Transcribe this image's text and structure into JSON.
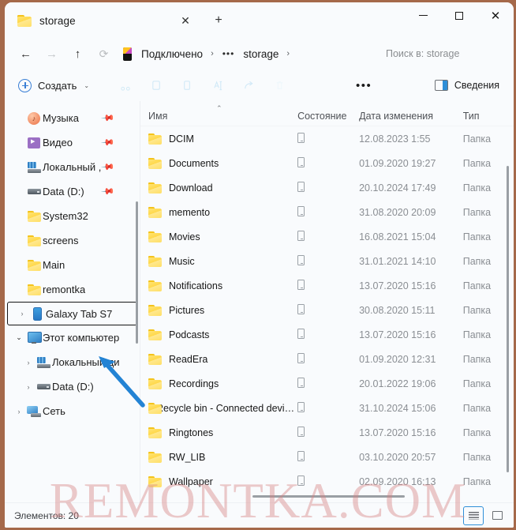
{
  "window": {
    "tab_title": "storage",
    "tab_icon": "folder-icon",
    "close_tab": "✕",
    "new_tab": "+",
    "minimize": "—",
    "maximize": "□",
    "close": "✕"
  },
  "nav": {
    "back": "←",
    "forward": "→",
    "up": "↑",
    "refresh": "⟳"
  },
  "breadcrumb": {
    "device_icon": "phone-icon",
    "items": [
      "Подключено",
      "storage"
    ],
    "ellipsis": "•••",
    "separator": "›"
  },
  "search": {
    "placeholder": "Поиск в: storage",
    "value": ""
  },
  "toolbar": {
    "new_label": "Создать",
    "new_chevron": "⌄",
    "icons": [
      "cut-icon",
      "copy-icon",
      "paste-icon",
      "rename-icon",
      "share-icon",
      "delete-icon"
    ],
    "more_label": "•••",
    "details_label": "Сведения"
  },
  "sidebar": {
    "items": [
      {
        "label": "Музыка",
        "icon": "music-icon",
        "chevron": "",
        "pinned": true,
        "indent": 0
      },
      {
        "label": "Видео",
        "icon": "video-icon",
        "chevron": "",
        "pinned": true,
        "indent": 0
      },
      {
        "label": "Локальный ,",
        "icon": "local-disk-icon",
        "chevron": "",
        "pinned": true,
        "indent": 0
      },
      {
        "label": "Data (D:)",
        "icon": "drive-icon",
        "chevron": "",
        "pinned": true,
        "indent": 0
      },
      {
        "label": "System32",
        "icon": "folder-icon",
        "chevron": "",
        "pinned": false,
        "indent": 0
      },
      {
        "label": "screens",
        "icon": "folder-icon",
        "chevron": "",
        "pinned": false,
        "indent": 0
      },
      {
        "label": "Main",
        "icon": "folder-icon",
        "chevron": "",
        "pinned": false,
        "indent": 0
      },
      {
        "label": "remontka",
        "icon": "folder-icon",
        "chevron": "",
        "pinned": false,
        "indent": 0
      },
      {
        "label": "Galaxy Tab S7",
        "icon": "tablet-icon",
        "chevron": "›",
        "pinned": false,
        "indent": 0,
        "highlight": true
      },
      {
        "label": "Этот компьютер",
        "icon": "this-pc-icon",
        "chevron": "⌄",
        "pinned": false,
        "indent": 0
      },
      {
        "label": "Локальный ди",
        "icon": "local-disk-icon",
        "chevron": "›",
        "pinned": false,
        "indent": 1
      },
      {
        "label": "Data (D:)",
        "icon": "drive-icon",
        "chevron": "›",
        "pinned": false,
        "indent": 1
      },
      {
        "label": "Сеть",
        "icon": "network-icon",
        "chevron": "›",
        "pinned": false,
        "indent": 0
      }
    ],
    "pin_glyph": "📌"
  },
  "columns": {
    "name": "Имя",
    "status": "Состояние",
    "date": "Дата изменения",
    "type": "Тип",
    "sort_arrow": "⌃"
  },
  "files": [
    {
      "name": "DCIM",
      "status": "device-icon",
      "date": "12.08.2023 1:55",
      "type": "Папка"
    },
    {
      "name": "Documents",
      "status": "device-icon",
      "date": "01.09.2020 19:27",
      "type": "Папка"
    },
    {
      "name": "Download",
      "status": "device-icon",
      "date": "20.10.2024 17:49",
      "type": "Папка"
    },
    {
      "name": "memento",
      "status": "device-icon",
      "date": "31.08.2020 20:09",
      "type": "Папка"
    },
    {
      "name": "Movies",
      "status": "device-icon",
      "date": "16.08.2021 15:04",
      "type": "Папка"
    },
    {
      "name": "Music",
      "status": "device-icon",
      "date": "31.01.2021 14:10",
      "type": "Папка"
    },
    {
      "name": "Notifications",
      "status": "device-icon",
      "date": "13.07.2020 15:16",
      "type": "Папка"
    },
    {
      "name": "Pictures",
      "status": "device-icon",
      "date": "30.08.2020 15:11",
      "type": "Папка"
    },
    {
      "name": "Podcasts",
      "status": "device-icon",
      "date": "13.07.2020 15:16",
      "type": "Папка"
    },
    {
      "name": "ReadEra",
      "status": "device-icon",
      "date": "01.09.2020 12:31",
      "type": "Папка"
    },
    {
      "name": "Recordings",
      "status": "device-icon",
      "date": "20.01.2022 19:06",
      "type": "Папка"
    },
    {
      "name": "Recycle bin - Connected devi…",
      "status": "device-icon",
      "date": "31.10.2024 15:06",
      "type": "Папка"
    },
    {
      "name": "Ringtones",
      "status": "device-icon",
      "date": "13.07.2020 15:16",
      "type": "Папка"
    },
    {
      "name": "RW_LIB",
      "status": "device-icon",
      "date": "03.10.2020 20:57",
      "type": "Папка"
    },
    {
      "name": "Wallpaper",
      "status": "device-icon",
      "date": "02.09.2020 16:13",
      "type": "Папка"
    }
  ],
  "statusbar": {
    "count_label": "Элементов: 20",
    "view_list": "list-view-icon",
    "view_tiles": "tiles-view-icon"
  },
  "annotations": {
    "arrow": "blue-arrow-pointer",
    "watermark": "REMONTKA.COM"
  },
  "colors": {
    "accent": "#2f8fd8",
    "folder": "#ffd84a",
    "window_border": "#a5694a",
    "watermark": "#d68080",
    "arrow": "#2383d4"
  }
}
